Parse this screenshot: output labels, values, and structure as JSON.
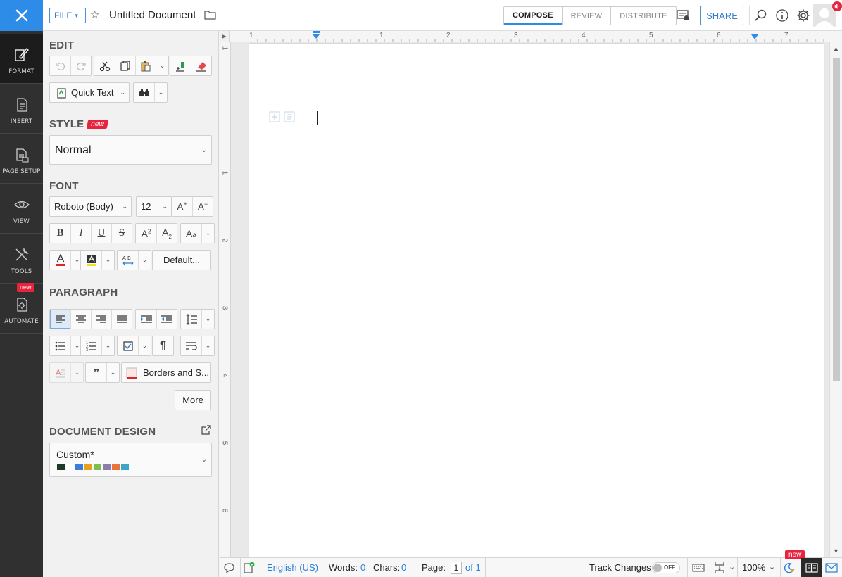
{
  "topbar": {
    "file_label": "FILE",
    "doc_title": "Untitled Document",
    "tabs": [
      "COMPOSE",
      "REVIEW",
      "DISTRIBUTE"
    ],
    "share_label": "SHARE"
  },
  "rail": {
    "items": [
      {
        "label": "FORMAT",
        "icon": "format-icon"
      },
      {
        "label": "INSERT",
        "icon": "insert-icon"
      },
      {
        "label": "PAGE SETUP",
        "icon": "page-setup-icon"
      },
      {
        "label": "VIEW",
        "icon": "eye-icon"
      },
      {
        "label": "TOOLS",
        "icon": "tools-icon"
      },
      {
        "label": "AUTOMATE",
        "icon": "automate-icon"
      }
    ],
    "new_badge": "new"
  },
  "panel": {
    "edit_title": "EDIT",
    "quick_text": "Quick Text",
    "style_title": "STYLE",
    "style_badge": "new",
    "style_value": "Normal",
    "font_title": "FONT",
    "font_family": "Roboto (Body)",
    "font_size": "12",
    "default_label": "Default...",
    "paragraph_title": "PARAGRAPH",
    "borders_label": "Borders and S...",
    "more_label": "More",
    "design_title": "DOCUMENT DESIGN",
    "design_value": "Custom*",
    "design_swatches": [
      "#1f3a2b",
      "#ffffff",
      "#3b7dd8",
      "#e6a11c",
      "#7cbf4a",
      "#8b7fa8",
      "#e8743b",
      "#3aa7c9"
    ]
  },
  "ruler": {
    "h_numbers": [
      "1",
      "1",
      "2",
      "3",
      "4",
      "5",
      "6",
      "7"
    ],
    "v_numbers": [
      "1",
      "1",
      "2",
      "3",
      "4",
      "5",
      "6"
    ]
  },
  "status": {
    "language": "English (US)",
    "words_label": "Words:",
    "words_value": "0",
    "chars_label": "Chars:",
    "chars_value": "0",
    "page_label": "Page:",
    "page_value": "1",
    "page_of": "of 1",
    "track_label": "Track Changes",
    "track_state": "OFF",
    "zoom": "100%",
    "new_badge": "new"
  },
  "colors": {
    "accent": "#2c8ce8",
    "rail_bg": "#303030",
    "badge": "#e8233d"
  }
}
